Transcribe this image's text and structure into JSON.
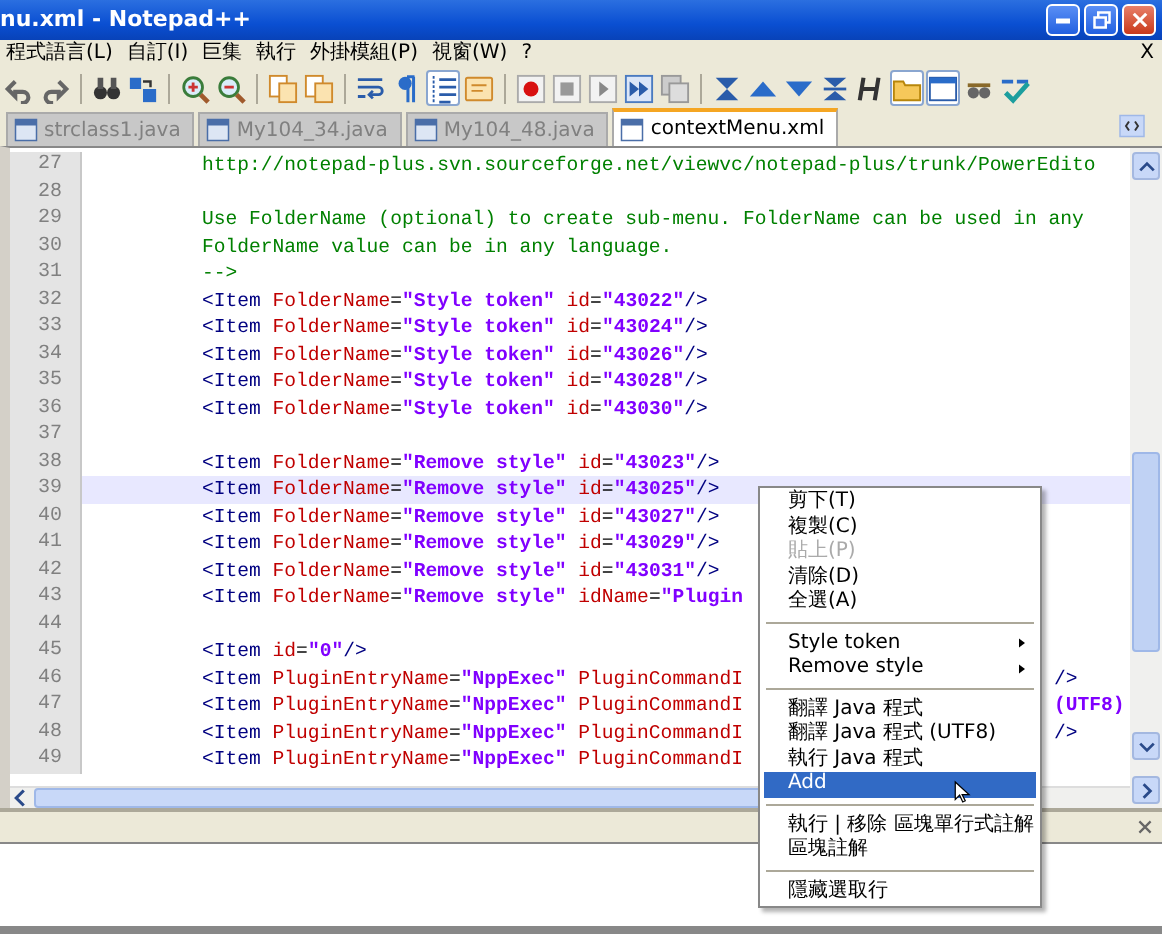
{
  "window": {
    "title": "nu.xml - Notepad++"
  },
  "menu_bar": [
    "程式語言(L)",
    "自訂(I)",
    "巨集",
    "執行",
    "外掛模組(P)",
    "視窗(W)",
    "?"
  ],
  "menu_close": "X",
  "toolbar": [
    {
      "kind": "undo"
    },
    {
      "kind": "redo"
    },
    {
      "kind": "separator"
    },
    {
      "kind": "find"
    },
    {
      "kind": "replace"
    },
    {
      "kind": "separator"
    },
    {
      "kind": "zoom-in"
    },
    {
      "kind": "zoom-out"
    },
    {
      "kind": "separator"
    },
    {
      "kind": "sync"
    },
    {
      "kind": "sync"
    },
    {
      "kind": "separator"
    },
    {
      "kind": "wrap"
    },
    {
      "kind": "pilcrow"
    },
    {
      "kind": "indent",
      "pressed": true
    },
    {
      "kind": "note"
    },
    {
      "kind": "separator"
    },
    {
      "kind": "record"
    },
    {
      "kind": "stop"
    },
    {
      "kind": "play"
    },
    {
      "kind": "play-multi"
    },
    {
      "kind": "save-macro"
    },
    {
      "kind": "separator"
    },
    {
      "kind": "collapse"
    },
    {
      "kind": "up"
    },
    {
      "kind": "down"
    },
    {
      "kind": "expand"
    },
    {
      "kind": "heading"
    },
    {
      "kind": "folder",
      "pressed": true
    },
    {
      "kind": "window",
      "pressed": true
    },
    {
      "kind": "glasses"
    },
    {
      "kind": "spellcheck"
    }
  ],
  "tabs": [
    {
      "label": "strclass1.java",
      "selected": false
    },
    {
      "label": "My104_34.java",
      "selected": false
    },
    {
      "label": "My104_48.java",
      "selected": false
    },
    {
      "label": "contextMenu.xml",
      "selected": true
    }
  ],
  "editor": {
    "lines": [
      {
        "number": "27",
        "current": false,
        "tokens": [
          {
            "kind": "comment",
            "text": "http://notepad-plus.svn.sourceforge.net/viewvc/notepad-plus/trunk/PowerEdito"
          }
        ]
      },
      {
        "number": "28"
      },
      {
        "number": "29",
        "current": false,
        "tokens": [
          {
            "kind": "comment",
            "text": "Use FolderName (optional) to create sub-menu. FolderName can be used in any"
          }
        ]
      },
      {
        "number": "30",
        "current": false,
        "tokens": [
          {
            "kind": "comment",
            "text": "FolderName value can be in any language."
          }
        ]
      },
      {
        "number": "31",
        "current": false,
        "tokens": [
          {
            "kind": "comment",
            "text": "-->"
          }
        ]
      },
      {
        "number": "32",
        "current": false,
        "tokens": [
          {
            "kind": "tag",
            "text": "<Item "
          },
          {
            "kind": "attr",
            "text": "FolderName"
          },
          {
            "kind": "eq",
            "text": "="
          },
          {
            "kind": "value",
            "text": "\"Style token\" "
          },
          {
            "kind": "attr",
            "text": "id"
          },
          {
            "kind": "eq",
            "text": "="
          },
          {
            "kind": "value",
            "text": "\"43022\""
          },
          {
            "kind": "tag",
            "text": "/>"
          }
        ]
      },
      {
        "number": "33",
        "current": false,
        "tokens": [
          {
            "kind": "tag",
            "text": "<Item "
          },
          {
            "kind": "attr",
            "text": "FolderName"
          },
          {
            "kind": "eq",
            "text": "="
          },
          {
            "kind": "value",
            "text": "\"Style token\" "
          },
          {
            "kind": "attr",
            "text": "id"
          },
          {
            "kind": "eq",
            "text": "="
          },
          {
            "kind": "value",
            "text": "\"43024\""
          },
          {
            "kind": "tag",
            "text": "/>"
          }
        ]
      },
      {
        "number": "34",
        "current": false,
        "tokens": [
          {
            "kind": "tag",
            "text": "<Item "
          },
          {
            "kind": "attr",
            "text": "FolderName"
          },
          {
            "kind": "eq",
            "text": "="
          },
          {
            "kind": "value",
            "text": "\"Style token\" "
          },
          {
            "kind": "attr",
            "text": "id"
          },
          {
            "kind": "eq",
            "text": "="
          },
          {
            "kind": "value",
            "text": "\"43026\""
          },
          {
            "kind": "tag",
            "text": "/>"
          }
        ]
      },
      {
        "number": "35",
        "current": false,
        "tokens": [
          {
            "kind": "tag",
            "text": "<Item "
          },
          {
            "kind": "attr",
            "text": "FolderName"
          },
          {
            "kind": "eq",
            "text": "="
          },
          {
            "kind": "value",
            "text": "\"Style token\" "
          },
          {
            "kind": "attr",
            "text": "id"
          },
          {
            "kind": "eq",
            "text": "="
          },
          {
            "kind": "value",
            "text": "\"43028\""
          },
          {
            "kind": "tag",
            "text": "/>"
          }
        ]
      },
      {
        "number": "36",
        "current": false,
        "tokens": [
          {
            "kind": "tag",
            "text": "<Item "
          },
          {
            "kind": "attr",
            "text": "FolderName"
          },
          {
            "kind": "eq",
            "text": "="
          },
          {
            "kind": "value",
            "text": "\"Style token\" "
          },
          {
            "kind": "attr",
            "text": "id"
          },
          {
            "kind": "eq",
            "text": "="
          },
          {
            "kind": "value",
            "text": "\"43030\""
          },
          {
            "kind": "tag",
            "text": "/>"
          }
        ]
      },
      {
        "number": "37"
      },
      {
        "number": "38",
        "current": false,
        "tokens": [
          {
            "kind": "tag",
            "text": "<Item "
          },
          {
            "kind": "attr",
            "text": "FolderName"
          },
          {
            "kind": "eq",
            "text": "="
          },
          {
            "kind": "value",
            "text": "\"Remove style\" "
          },
          {
            "kind": "attr",
            "text": "id"
          },
          {
            "kind": "eq",
            "text": "="
          },
          {
            "kind": "value",
            "text": "\"43023\""
          },
          {
            "kind": "tag",
            "text": "/>"
          }
        ]
      },
      {
        "number": "39",
        "current": true,
        "tokens": [
          {
            "kind": "tag",
            "text": "<Item "
          },
          {
            "kind": "attr",
            "text": "FolderName"
          },
          {
            "kind": "eq",
            "text": "="
          },
          {
            "kind": "value",
            "text": "\"Remove style\" "
          },
          {
            "kind": "attr",
            "text": "id"
          },
          {
            "kind": "eq",
            "text": "="
          },
          {
            "kind": "value",
            "text": "\"43025\""
          },
          {
            "kind": "tag",
            "text": "/>"
          }
        ]
      },
      {
        "number": "40",
        "current": false,
        "tokens": [
          {
            "kind": "tag",
            "text": "<Item "
          },
          {
            "kind": "attr",
            "text": "FolderName"
          },
          {
            "kind": "eq",
            "text": "="
          },
          {
            "kind": "value",
            "text": "\"Remove style\" "
          },
          {
            "kind": "attr",
            "text": "id"
          },
          {
            "kind": "eq",
            "text": "="
          },
          {
            "kind": "value",
            "text": "\"43027\""
          },
          {
            "kind": "tag",
            "text": "/>"
          }
        ]
      },
      {
        "number": "41",
        "current": false,
        "tokens": [
          {
            "kind": "tag",
            "text": "<Item "
          },
          {
            "kind": "attr",
            "text": "FolderName"
          },
          {
            "kind": "eq",
            "text": "="
          },
          {
            "kind": "value",
            "text": "\"Remove style\" "
          },
          {
            "kind": "attr",
            "text": "id"
          },
          {
            "kind": "eq",
            "text": "="
          },
          {
            "kind": "value",
            "text": "\"43029\""
          },
          {
            "kind": "tag",
            "text": "/>"
          }
        ]
      },
      {
        "number": "42",
        "current": false,
        "tokens": [
          {
            "kind": "tag",
            "text": "<Item "
          },
          {
            "kind": "attr",
            "text": "FolderName"
          },
          {
            "kind": "eq",
            "text": "="
          },
          {
            "kind": "value",
            "text": "\"Remove style\" "
          },
          {
            "kind": "attr",
            "text": "id"
          },
          {
            "kind": "eq",
            "text": "="
          },
          {
            "kind": "value",
            "text": "\"43031\""
          },
          {
            "kind": "tag",
            "text": "/>"
          }
        ]
      },
      {
        "number": "43",
        "current": false,
        "tokens": [
          {
            "kind": "tag",
            "text": "<Item "
          },
          {
            "kind": "attr",
            "text": "FolderName"
          },
          {
            "kind": "eq",
            "text": "="
          },
          {
            "kind": "value",
            "text": "\"Remove style\" "
          },
          {
            "kind": "attr",
            "text": "idName"
          },
          {
            "kind": "eq",
            "text": "="
          },
          {
            "kind": "value",
            "text": "\"Plugin"
          }
        ]
      },
      {
        "number": "44"
      },
      {
        "number": "45",
        "current": false,
        "tokens": [
          {
            "kind": "tag",
            "text": "<Item "
          },
          {
            "kind": "attr",
            "text": "id"
          },
          {
            "kind": "eq",
            "text": "="
          },
          {
            "kind": "value",
            "text": "\"0\""
          },
          {
            "kind": "tag",
            "text": "/>"
          }
        ]
      },
      {
        "number": "46",
        "current": false,
        "tokens": [
          {
            "kind": "tag",
            "text": "<Item "
          },
          {
            "kind": "attr",
            "text": "PluginEntryName"
          },
          {
            "kind": "eq",
            "text": "="
          },
          {
            "kind": "value",
            "text": "\"NppExec\" "
          },
          {
            "kind": "attr",
            "text": "PluginCommandI"
          }
        ],
        "tail": {
          "kind": "tag",
          "text": "/>"
        }
      },
      {
        "number": "47",
        "current": false,
        "tokens": [
          {
            "kind": "tag",
            "text": "<Item "
          },
          {
            "kind": "attr",
            "text": "PluginEntryName"
          },
          {
            "kind": "eq",
            "text": "="
          },
          {
            "kind": "value",
            "text": "\"NppExec\" "
          },
          {
            "kind": "attr",
            "text": "PluginCommandI"
          }
        ],
        "tail": {
          "kind": "value",
          "text": "(UTF8)"
        }
      },
      {
        "number": "48",
        "current": false,
        "tokens": [
          {
            "kind": "tag",
            "text": "<Item "
          },
          {
            "kind": "attr",
            "text": "PluginEntryName"
          },
          {
            "kind": "eq",
            "text": "="
          },
          {
            "kind": "value",
            "text": "\"NppExec\" "
          },
          {
            "kind": "attr",
            "text": "PluginCommandI"
          }
        ],
        "tail": {
          "kind": "tag",
          "text": "/>"
        }
      },
      {
        "number": "49",
        "current": false,
        "tokens": [
          {
            "kind": "tag",
            "text": "<Item "
          },
          {
            "kind": "attr",
            "text": "PluginEntryName"
          },
          {
            "kind": "eq",
            "text": "="
          },
          {
            "kind": "value",
            "text": "\"NppExec\" "
          },
          {
            "kind": "attr",
            "text": "PluginCommandI"
          }
        ]
      }
    ]
  },
  "context_menu": [
    {
      "kind": "item",
      "label": "剪下(T)",
      "disabled": false,
      "selected": false
    },
    {
      "kind": "item",
      "label": "複製(C)",
      "disabled": false,
      "selected": false
    },
    {
      "kind": "item",
      "label": "貼上(P)",
      "disabled": true,
      "selected": false
    },
    {
      "kind": "item",
      "label": "清除(D)",
      "disabled": false,
      "selected": false
    },
    {
      "kind": "item",
      "label": "全選(A)",
      "disabled": false,
      "selected": false
    },
    {
      "kind": "separator"
    },
    {
      "kind": "submenu",
      "label": "Style token",
      "disabled": false,
      "selected": false
    },
    {
      "kind": "submenu",
      "label": "Remove style",
      "disabled": false,
      "selected": false
    },
    {
      "kind": "separator"
    },
    {
      "kind": "item",
      "label": "翻譯 Java 程式",
      "disabled": false,
      "selected": false
    },
    {
      "kind": "item",
      "label": "翻譯 Java 程式 (UTF8)",
      "disabled": false,
      "selected": false
    },
    {
      "kind": "item",
      "label": "執行 Java 程式",
      "disabled": false,
      "selected": false
    },
    {
      "kind": "item",
      "label": "Add",
      "disabled": false,
      "selected": true
    },
    {
      "kind": "separator"
    },
    {
      "kind": "item",
      "label": "執行 | 移除 區塊單行式註解",
      "disabled": false,
      "selected": false
    },
    {
      "kind": "item",
      "label": "區塊註解",
      "disabled": false,
      "selected": false
    },
    {
      "kind": "separator"
    },
    {
      "kind": "item",
      "label": "隱藏選取行",
      "disabled": false,
      "selected": false
    }
  ]
}
